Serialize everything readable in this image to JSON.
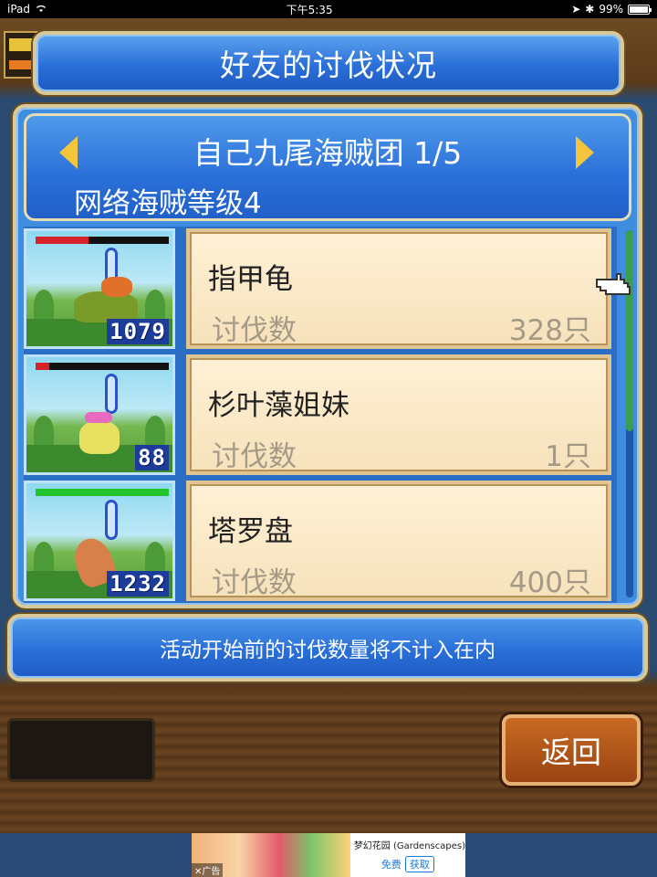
{
  "status_bar": {
    "device": "iPad",
    "time": "下午5:35",
    "battery": "99%"
  },
  "title": "好友的讨伐状况",
  "crew": {
    "name": "自己九尾海贼团 1/5",
    "level": "网络海贼等级4"
  },
  "list": [
    {
      "name": "指甲龟",
      "label": "讨伐数",
      "value": "328只",
      "badge": "1079",
      "hp_fill": 0.4,
      "hp_color": "#d8222a"
    },
    {
      "name": "杉叶藻姐妹",
      "label": "讨伐数",
      "value": "1只",
      "badge": "88",
      "hp_fill": 0.1,
      "hp_color": "#d8222a"
    },
    {
      "name": "塔罗盘",
      "label": "讨伐数",
      "value": "400只",
      "badge": "1232",
      "hp_fill": 1.0,
      "hp_color": "#22c52e"
    }
  ],
  "notice": "活动开始前的讨伐数量将不计入在内",
  "back_button": "返回",
  "ad": {
    "title": "梦幻花园 (Gardenscapes)",
    "badge": "广告",
    "free": "免费",
    "get": "获取"
  },
  "colors": {
    "panel_blue": "#2a6fd8",
    "card_bg": "#f6e2bb",
    "accent_gold": "#f2c53c",
    "button_orange": "#c86a22"
  },
  "icons": [
    "wifi-icon",
    "arrow-left-icon",
    "arrow-right-icon",
    "pointing-hand-icon",
    "ad-close-icon"
  ]
}
